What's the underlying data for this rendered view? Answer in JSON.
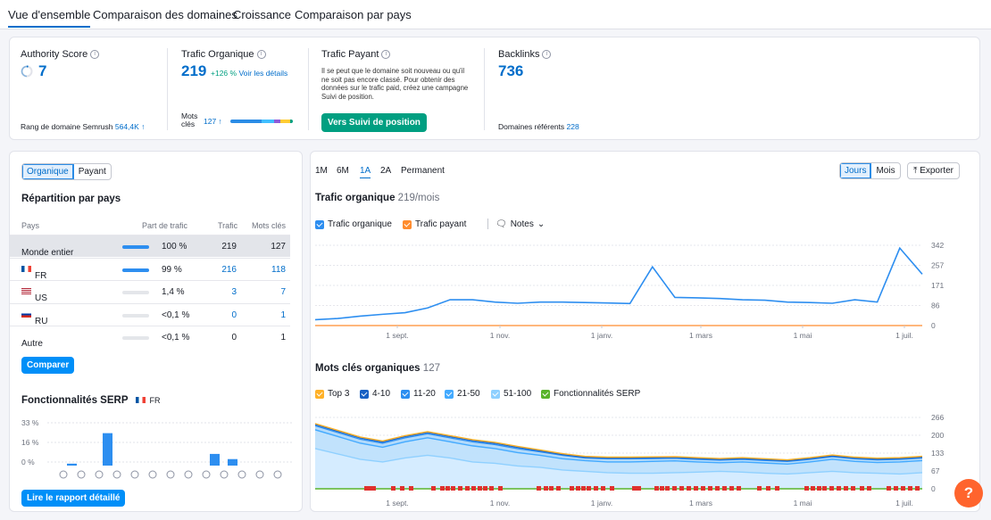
{
  "tabs": [
    "Vue d'ensemble",
    "Comparaison des domaines",
    "Croissance",
    "Comparaison par pays"
  ],
  "metrics": {
    "authority": {
      "title": "Authority Score",
      "value": "7",
      "foot_label": "Rang de domaine Semrush",
      "foot_value": "564,4K ↑"
    },
    "organic": {
      "title": "Trafic Organique",
      "value": "219",
      "change": "+126 %",
      "details_link": "Voir les détails",
      "kw_label": "Mots clés",
      "kw_value": "127 ↑"
    },
    "paid": {
      "title": "Trafic Payant",
      "text": "Il se peut que le domaine soit nouveau ou qu'il ne soit pas encore classé. Pour obtenir des données sur le trafic paid, créez une campagne Suivi de position.",
      "button": "Vers Suivi de position"
    },
    "backlinks": {
      "title": "Backlinks",
      "value": "736",
      "foot_label": "Domaines référents",
      "foot_value": "228"
    }
  },
  "left": {
    "toggle": [
      "Organique",
      "Payant"
    ],
    "country_title": "Répartition par pays",
    "columns": [
      "Pays",
      "Part de trafic",
      "Trafic",
      "Mots clés"
    ],
    "rows": [
      {
        "country": "Monde entier",
        "flag": "",
        "share": "100 %",
        "share_value": 100,
        "traffic": "219",
        "keywords": "127"
      },
      {
        "country": "FR",
        "flag": "fr",
        "share": "99 %",
        "share_value": 99,
        "traffic": "216",
        "keywords": "118"
      },
      {
        "country": "US",
        "flag": "us",
        "share": "1,4 %",
        "share_value": 1.4,
        "traffic": "3",
        "keywords": "7"
      },
      {
        "country": "RU",
        "flag": "ru",
        "share": "<0,1 %",
        "share_value": 0.1,
        "traffic": "0",
        "keywords": "1"
      },
      {
        "country": "Autre",
        "flag": "",
        "share": "<0,1 %",
        "share_value": 0.1,
        "traffic": "0",
        "keywords": "1"
      }
    ],
    "compare_button": "Comparer",
    "serp_title": "Fonctionnalités SERP",
    "serp_country": "FR",
    "serp_yticks": [
      "33 %",
      "16 %",
      "0 %"
    ],
    "serp_values": [
      0,
      1.5,
      0,
      25,
      0,
      0,
      0,
      0,
      0,
      9,
      5,
      0,
      0,
      0
    ],
    "serp_icons": [
      "trophy-icon",
      "link-icon",
      "star-icon",
      "image-icon",
      "play-icon",
      "video-icon",
      "play-circle-icon",
      "comment-icon",
      "location-icon",
      "graduation-icon",
      "doc-icon",
      "briefcase-icon",
      "x-icon"
    ],
    "report_button": "Lire le rapport détaillé"
  },
  "right": {
    "periods": [
      "1M",
      "6M",
      "1A",
      "2A",
      "Permanent"
    ],
    "active_period": "1A",
    "granularity": [
      "Jours",
      "Mois"
    ],
    "export": "Exporter",
    "traffic_title": "Trafic organique",
    "traffic_sub": "219/mois",
    "traffic_legend": [
      "Trafic organique",
      "Trafic payant",
      "Notes"
    ],
    "traffic_yticks": [
      "342",
      "257",
      "171",
      "86",
      "0"
    ],
    "x_labels": [
      "1 sept.",
      "1 nov.",
      "1 janv.",
      "1 mars",
      "1 mai",
      "1 juil."
    ],
    "kw_title": "Mots clés organiques",
    "kw_sub": "127",
    "kw_legend": [
      "Top 3",
      "4-10",
      "11-20",
      "21-50",
      "51-100",
      "Fonctionnalités SERP"
    ],
    "kw_yticks": [
      "266",
      "200",
      "133",
      "67",
      "0"
    ]
  },
  "colors": {
    "accent": "#006dca",
    "green": "#009f81",
    "orange": "#ff642d"
  },
  "chart_data": [
    {
      "type": "line",
      "title": "Trafic organique",
      "x": [
        "1 sept.",
        "1 nov.",
        "1 janv.",
        "1 mars",
        "1 mai",
        "1 juil."
      ],
      "ylim": [
        0,
        342
      ],
      "series": [
        {
          "name": "Trafic organique",
          "values": [
            25,
            30,
            40,
            48,
            55,
            75,
            110,
            110,
            100,
            95,
            100,
            100,
            98,
            96,
            94,
            250,
            120,
            118,
            115,
            110,
            108,
            100,
            98,
            95,
            110,
            100,
            330,
            219
          ]
        },
        {
          "name": "Trafic payant",
          "values": [
            0,
            0,
            0,
            0,
            0,
            0,
            0,
            0,
            0,
            0,
            0,
            0,
            0,
            0,
            0,
            0,
            0,
            0,
            0,
            0,
            0,
            0,
            0,
            0,
            0,
            0,
            0,
            0
          ]
        }
      ]
    },
    {
      "type": "area",
      "title": "Mots clés organiques",
      "x": [
        "1 sept.",
        "1 nov.",
        "1 janv.",
        "1 mars",
        "1 mai",
        "1 juil."
      ],
      "ylim": [
        0,
        266
      ],
      "series": [
        {
          "name": "51-100",
          "values": [
            150,
            130,
            110,
            100,
            115,
            125,
            115,
            100,
            95,
            85,
            80,
            70,
            65,
            60,
            58,
            58,
            60,
            62,
            65,
            62,
            58,
            55,
            60,
            65,
            60,
            58,
            55,
            60
          ]
        },
        {
          "name": "21-50",
          "values": [
            220,
            195,
            170,
            155,
            175,
            190,
            175,
            160,
            150,
            135,
            125,
            112,
            105,
            100,
            100,
            102,
            104,
            100,
            97,
            100,
            96,
            92,
            100,
            110,
            102,
            98,
            100,
            105
          ]
        },
        {
          "name": "11-20",
          "values": [
            235,
            210,
            185,
            170,
            190,
            205,
            190,
            175,
            165,
            150,
            138,
            125,
            115,
            112,
            112,
            113,
            114,
            110,
            107,
            110,
            106,
            102,
            110,
            120,
            112,
            108,
            110,
            115
          ]
        },
        {
          "name": "4-10",
          "values": [
            240,
            215,
            190,
            175,
            195,
            210,
            195,
            180,
            170,
            155,
            142,
            128,
            118,
            115,
            115,
            116,
            117,
            113,
            110,
            113,
            109,
            105,
            113,
            123,
            115,
            111,
            113,
            118
          ]
        },
        {
          "name": "Top 3",
          "values": [
            243,
            218,
            193,
            178,
            198,
            213,
            198,
            183,
            173,
            158,
            145,
            131,
            121,
            118,
            118,
            119,
            120,
            116,
            113,
            116,
            112,
            108,
            116,
            126,
            118,
            114,
            116,
            121
          ]
        }
      ]
    }
  ]
}
